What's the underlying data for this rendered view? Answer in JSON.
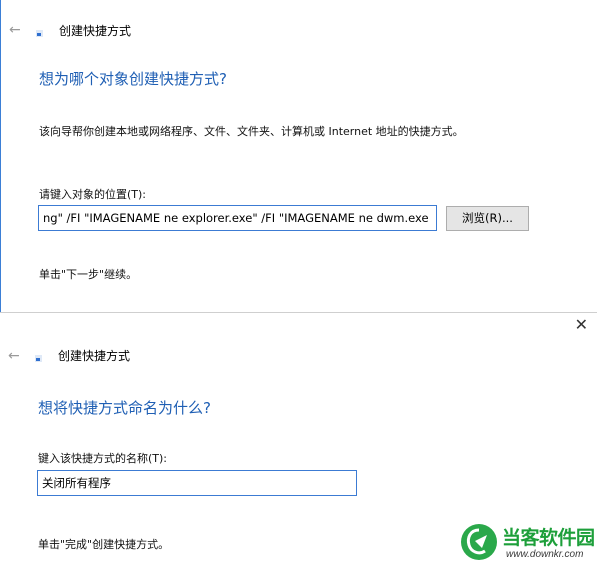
{
  "wizard1": {
    "window_title": "创建快捷方式",
    "heading": "想为哪个对象创建快捷方式?",
    "description": "该向导帮你创建本地或网络程序、文件、文件夹、计算机或 Internet 地址的快捷方式。",
    "location_label": "请键入对象的位置(T):",
    "location_value": "ng\" /FI \"IMAGENAME ne explorer.exe\" /FI \"IMAGENAME ne dwm.exe",
    "browse_label": "浏览(R)...",
    "next_hint": "单击\"下一步\"继续。"
  },
  "wizard2": {
    "window_title": "创建快捷方式",
    "heading": "想将快捷方式命名为什么?",
    "name_label": "键入该快捷方式的名称(T):",
    "name_value": "关闭所有程序",
    "finish_hint": "单击\"完成\"创建快捷方式。"
  },
  "icons": {
    "back": "back-arrow-icon",
    "close": "close-icon",
    "wizard": "shortcut-wizard-icon"
  },
  "watermark": {
    "name": "当客软件园",
    "url": "www.downkr.com"
  },
  "colors": {
    "heading": "#1f5fb4",
    "input_border": "#3c7bd3",
    "button_bg": "#e5e5e5",
    "watermark_green": "#1d9f3a"
  }
}
